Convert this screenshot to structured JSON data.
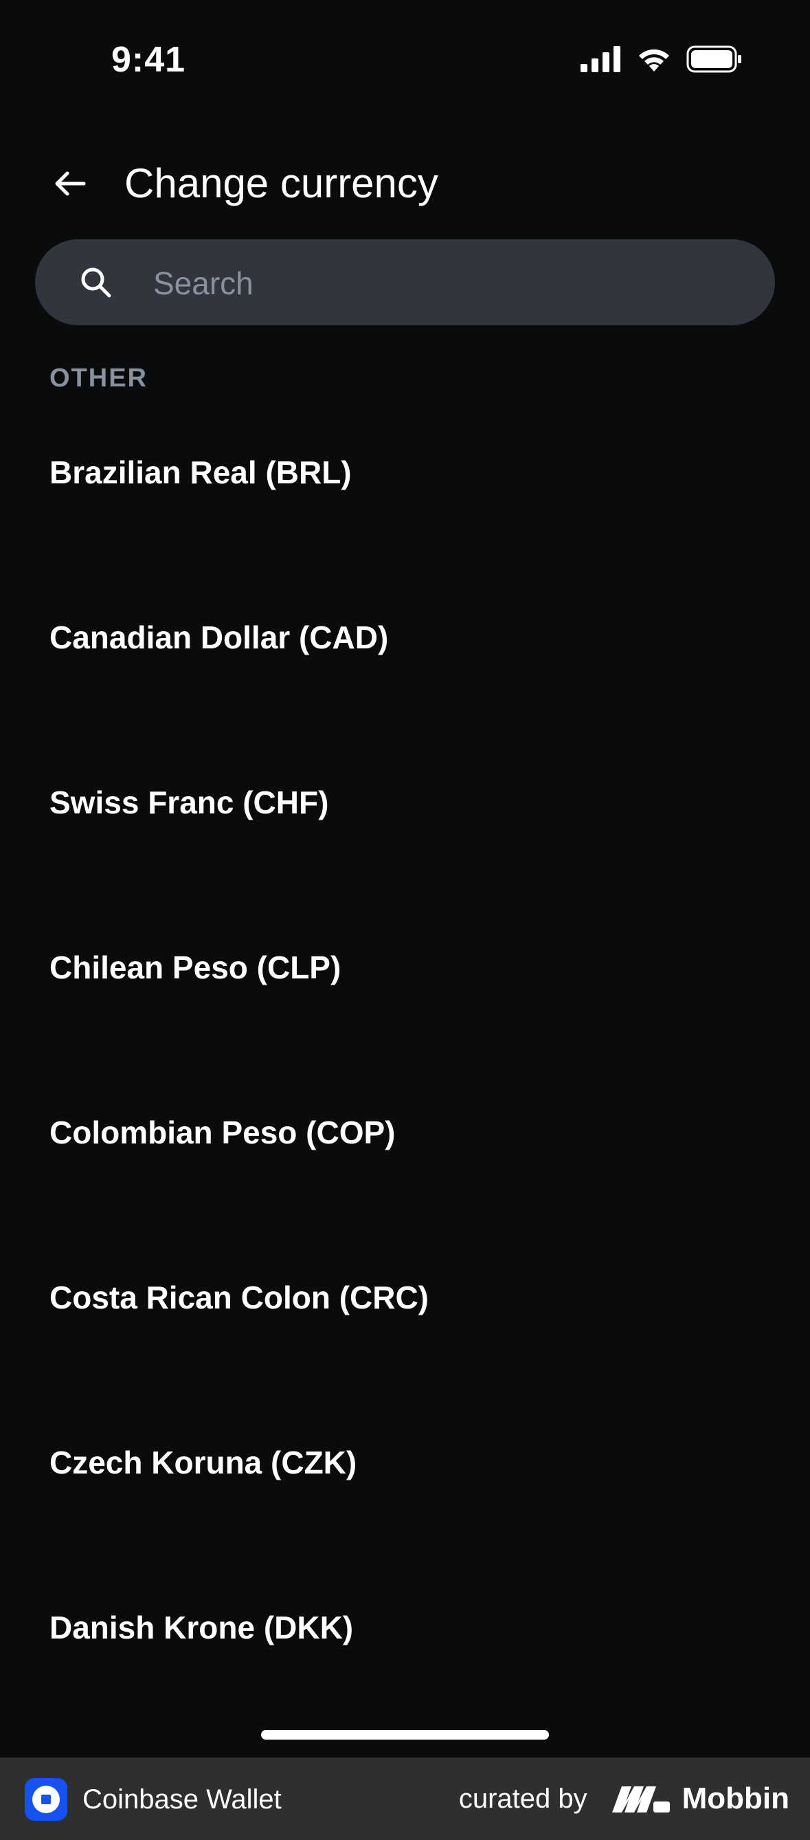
{
  "status_bar": {
    "time": "9:41",
    "icons": [
      "cellular-signal-icon",
      "wifi-icon",
      "battery-icon"
    ]
  },
  "header": {
    "back_icon": "arrow-left-icon",
    "title": "Change currency"
  },
  "search": {
    "icon": "search-icon",
    "placeholder": "Search",
    "value": ""
  },
  "section": {
    "label": "OTHER"
  },
  "currencies": [
    {
      "label": "Brazilian Real (BRL)"
    },
    {
      "label": "Canadian Dollar (CAD)"
    },
    {
      "label": "Swiss Franc (CHF)"
    },
    {
      "label": "Chilean Peso (CLP)"
    },
    {
      "label": "Colombian Peso (COP)"
    },
    {
      "label": "Costa Rican Colon (CRC)"
    },
    {
      "label": "Czech Koruna (CZK)"
    },
    {
      "label": "Danish Krone (DKK)"
    }
  ],
  "footer": {
    "app_name": "Coinbase Wallet",
    "curated_label": "curated by",
    "brand_name": "Mobbin"
  },
  "colors": {
    "background": "#0a0b0d",
    "search_background": "#32353d",
    "muted_text": "#8a919e",
    "footer_background": "#2e2f31",
    "coinbase_blue": "#1652f0"
  }
}
